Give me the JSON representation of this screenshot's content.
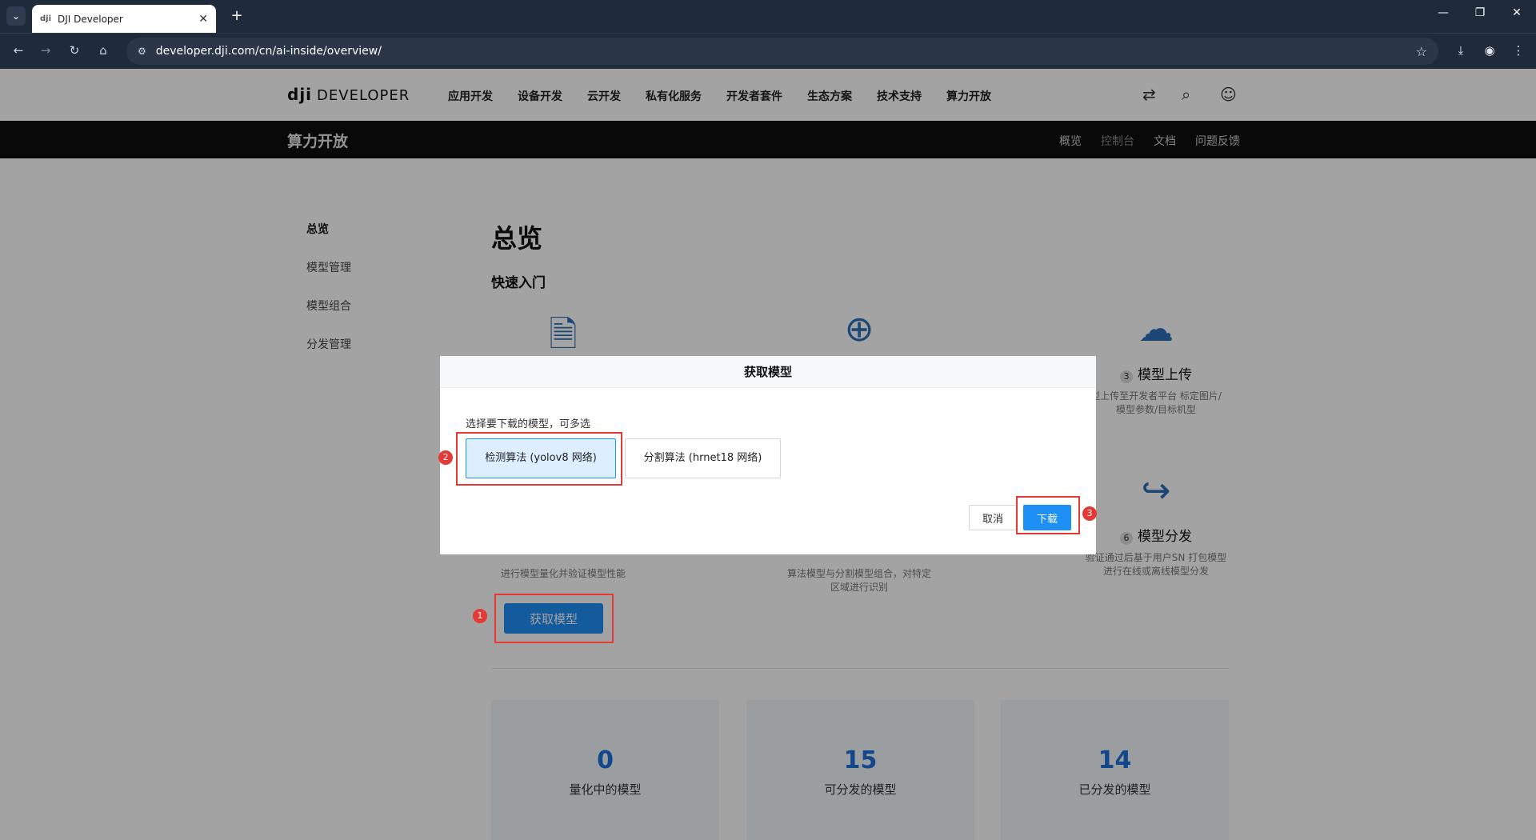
{
  "browser": {
    "tab_title": "DJI Developer",
    "tab_favicon": "dji",
    "url": "developer.dji.com/cn/ai-inside/overview/"
  },
  "header": {
    "logo": "dji",
    "logo_sub": "DEVELOPER",
    "nav": [
      "应用开发",
      "设备开发",
      "云开发",
      "私有化服务",
      "开发者套件",
      "生态方案",
      "技术支持",
      "算力开放"
    ]
  },
  "subbar": {
    "title": "算力开放",
    "nav": [
      "概览",
      "控制台",
      "文档",
      "问题反馈"
    ]
  },
  "sidebar": {
    "items": [
      "总览",
      "模型管理",
      "模型组合",
      "分发管理"
    ]
  },
  "main": {
    "title": "总览",
    "section_title": "快速入门",
    "features": [
      {
        "num": "3",
        "title": "模型上传",
        "desc_line1": "型上传至开发者平台 标定图片/",
        "desc_line2": "模型参数/目标机型"
      },
      {
        "num": "6",
        "title": "模型分发",
        "desc_line1": "验证通过后基于用户SN 打包模型",
        "desc_line2": "进行在线或离线模型分发"
      }
    ],
    "partial_desc": {
      "left": "进行模型量化并验证模型性能",
      "mid_line1": "算法模型与分割模型组合，对特定",
      "mid_line2": "区域进行识别"
    },
    "get_model_label": "获取模型",
    "stats": [
      {
        "value": "0",
        "label": "量化中的模型"
      },
      {
        "value": "15",
        "label": "可分发的模型"
      },
      {
        "value": "14",
        "label": "已分发的模型"
      }
    ]
  },
  "modal": {
    "title": "获取模型",
    "hint": "选择要下载的模型，可多选",
    "options": [
      "检测算法 (yolov8 网络)",
      "分割算法 (hrnet18 网络)"
    ],
    "cancel_label": "取消",
    "download_label": "下载"
  },
  "annotations": [
    "1",
    "2",
    "3"
  ]
}
